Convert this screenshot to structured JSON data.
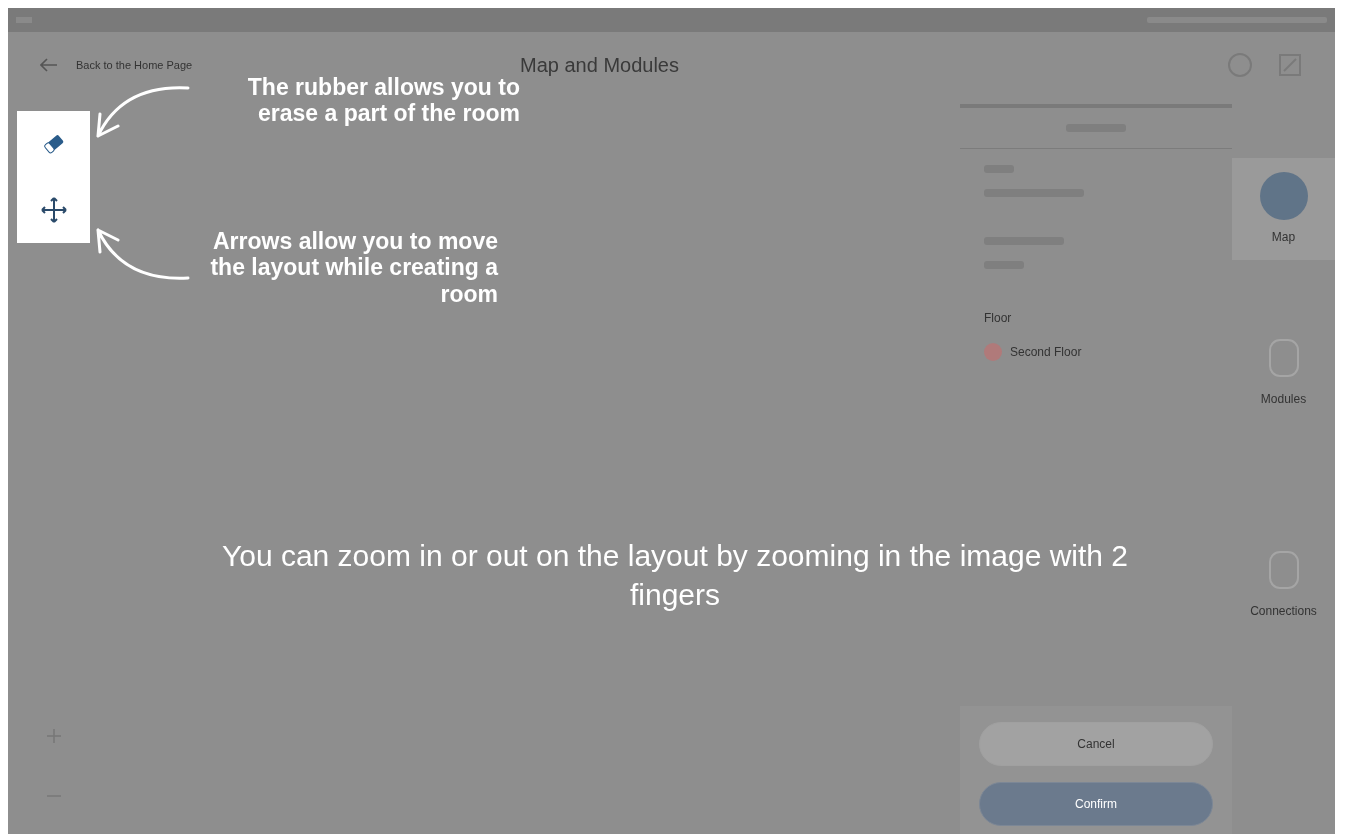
{
  "header": {
    "back_link": "Back to the Home Page",
    "title": "Map and Modules"
  },
  "panel": {
    "floor_label": "Floor",
    "floor_value": "Second Floor",
    "buttons": [
      {
        "label": "Cancel",
        "kind": "secondary"
      },
      {
        "label": "Confirm",
        "kind": "primary"
      }
    ]
  },
  "nav": [
    {
      "label": "Map",
      "selected": true
    },
    {
      "label": "Modules",
      "selected": false
    },
    {
      "label": "Connections",
      "selected": false
    }
  ],
  "annotations": [
    {
      "text": "The rubber allows you to erase a part of the room",
      "kind": "eraser"
    },
    {
      "text": "Arrows allow you to move the layout while creating a room",
      "kind": "move"
    },
    {
      "text": "You can zoom in or out on the layout by zooming in the image with 2 fingers",
      "kind": "center"
    }
  ]
}
